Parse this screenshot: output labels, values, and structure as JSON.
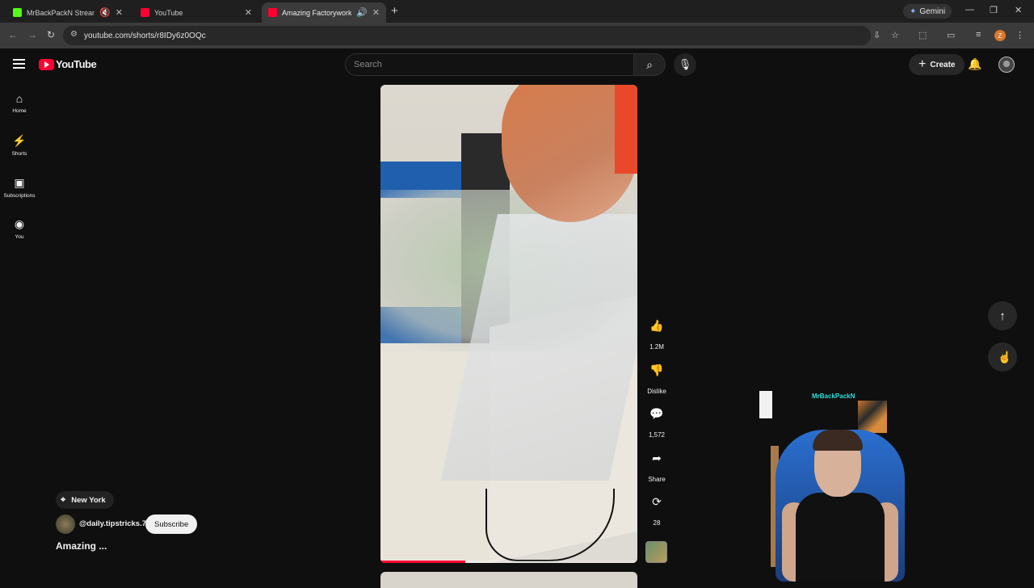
{
  "browser": {
    "tabs": [
      {
        "title": "MrBackPackN Stream - Wa",
        "favicon_color": "#53fc18"
      },
      {
        "title": "YouTube",
        "favicon_color": "#ff0033"
      },
      {
        "title": "Amazing Factorywork#rela",
        "favicon_color": "#ff0033"
      }
    ],
    "gemini_label": "Gemini",
    "url": "youtube.com/shorts/r8IDy6z0OQc"
  },
  "youtube": {
    "logo_text": "YouTube",
    "search_placeholder": "Search",
    "create_label": "Create",
    "sidebar": [
      {
        "label": "Home",
        "icon": "home-icon"
      },
      {
        "label": "Shorts",
        "icon": "shorts-icon"
      },
      {
        "label": "Subscriptions",
        "icon": "subscriptions-icon"
      },
      {
        "label": "You",
        "icon": "you-icon"
      }
    ]
  },
  "short": {
    "location": "New York",
    "channel": "@daily.tipstricks.7",
    "subscribe_label": "Subscribe",
    "title": "Amazing ...",
    "progress": 0.33,
    "actions": {
      "likes": "1.2M",
      "dislike": "Dislike",
      "comments": "1,572",
      "share": "Share",
      "remix": "28"
    }
  },
  "webcam": {
    "sign_text": "MrBackPackN"
  },
  "colors": {
    "brand_red": "#ff0033",
    "background": "#0f0f0f"
  }
}
